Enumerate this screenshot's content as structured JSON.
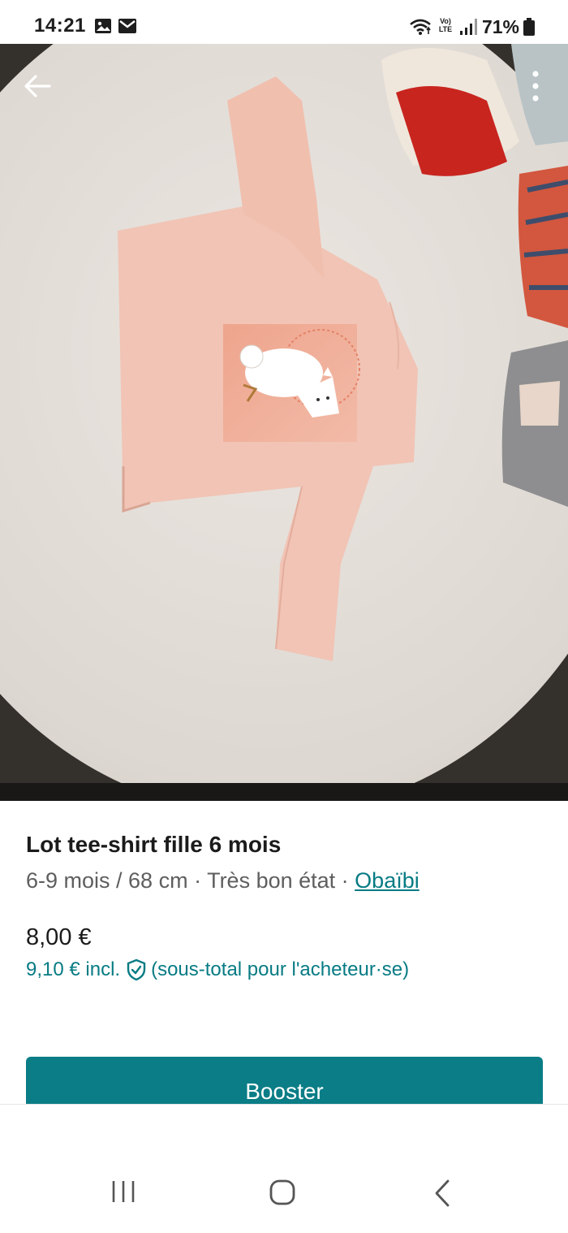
{
  "status_bar": {
    "time": "14:21",
    "battery": "71%",
    "network": "LTE",
    "icons": [
      "image-icon",
      "mail-icon",
      "wifi-icon",
      "volte-icon",
      "signal-icon",
      "battery-icon"
    ]
  },
  "photo": {
    "alt_icons": [
      "back-arrow-icon",
      "more-vertical-icon"
    ],
    "carousel": {
      "count": 5,
      "active_index": 2
    }
  },
  "product": {
    "title": "Lot tee-shirt fille 6 mois",
    "size": "6-9 mois / 68 cm",
    "separator": " · ",
    "condition": "Très bon état",
    "brand": "Obaïbi",
    "price": "8,00 €",
    "price_incl": "9,10 € incl.",
    "price_incl_note": "(sous-total pour l'acheteur·se)"
  },
  "actions": {
    "booster_label": "Booster"
  },
  "colors": {
    "accent": "#077b84",
    "button": "#0a7d86"
  }
}
